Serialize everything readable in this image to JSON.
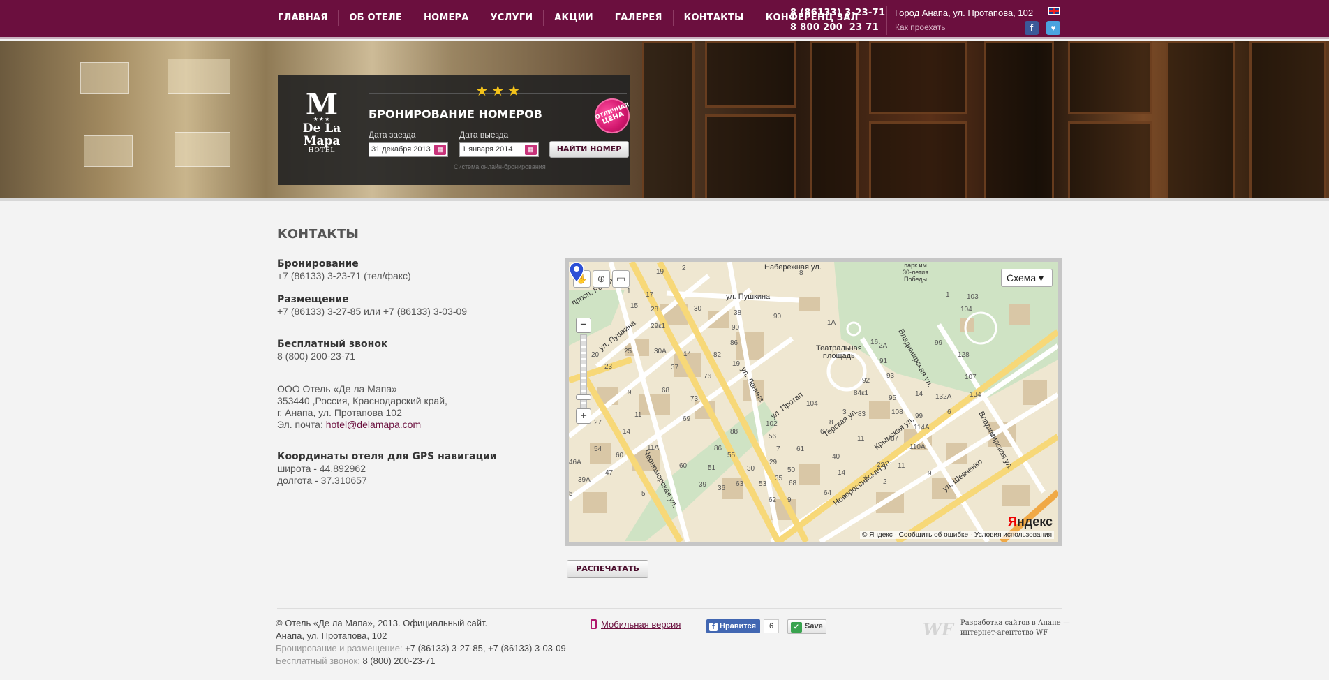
{
  "nav": {
    "items": [
      "ГЛАВНАЯ",
      "ОБ ОТЕЛЕ",
      "НОМЕРА",
      "УСЛУГИ",
      "АКЦИИ",
      "ГАЛЕРЕЯ",
      "КОНТАКТЫ",
      "КОНФЕРЕНЦ ЗАЛ"
    ]
  },
  "header": {
    "phone1": "8 (86133) 3-23-71",
    "phone2": "8 800 200  23 71",
    "address": "Город Анапа, ул. Протапова, 102",
    "route_link": "Как проехать",
    "social_facebook": "f",
    "social_vk": "♥"
  },
  "booking": {
    "logo_mono": "M",
    "logo_stars": "★★★",
    "logo_name": "De La Mapa",
    "logo_hotel": "HOTEL",
    "stars": "★★★",
    "title": "БРОНИРОВАНИЕ НОМЕРОВ",
    "checkin_label": "Дата заезда",
    "checkin_value": "31 декабря 2013",
    "checkout_label": "Дата выезда",
    "checkout_value": "1 января 2014",
    "find_button": "НАЙТИ НОМЕР",
    "system_note": "Система онлайн-бронирования",
    "badge_line1": "ОТЛИЧНАЯ",
    "badge_line2": "ЦЕНА"
  },
  "content": {
    "title": "КОНТАКТЫ",
    "booking_heading": "Бронирование",
    "booking_phone": "+7 (86133) 3-23-71 (тел/факс)",
    "placement_heading": "Размещение",
    "placement_phone": "+7 (86133) 3-27-85 или +7 (86133) 3-03-09",
    "free_heading": "Бесплатный звонок",
    "free_phone": "8 (800) 200-23-71",
    "company": "ООО Отель «Де ла Мапа»",
    "address_line1": "353440 ,Россия, Краснодарский край,",
    "address_line2": "г. Анапа, ул. Протапова 102",
    "email_label": "Эл. почта: ",
    "email": "hotel@delamapa.com",
    "gps_heading": "Координаты отеля для GPS навигации",
    "latitude": "широта - 44.892962",
    "longitude": "долгота - 37.310657",
    "print_button": "РАСПЕЧАТАТЬ"
  },
  "map": {
    "type_selector": "Схема ▾",
    "zoom_in": "+",
    "zoom_out": "−",
    "tool_hand": "✋",
    "tool_zoom": "⊕",
    "tool_ruler": "▭",
    "labels": {
      "naberezhnaya": "Набережная ул.",
      "park": "парк им\n30-летия\nПобеды",
      "pushkina_top": "ул. Пушкина",
      "revolution": "просп. Револю",
      "pushkina_left": "ул. Пушкина",
      "teatr": "Театральная\nплощадь",
      "lenina": "ул. Ленина",
      "protapova": "ул. Протап",
      "terskaya": "Терская ул.",
      "vladimir1": "Владимирская ул.",
      "vladimir2": "Владимирская ул.",
      "krymskaya": "Крымская ул.",
      "chernomorskaya": "Черноморская ул.",
      "novoross": "Новороссийская ул.",
      "shevchenko": "ул. Шевченко"
    },
    "footer_copy": "© Яндекс",
    "footer_error": "Сообщить об ошибке",
    "footer_terms": "Условия использования",
    "logo_y": "Я",
    "logo_rest": "ндекс"
  },
  "footer": {
    "copyright": "© Отель «Де ла Мапа», 2013. Официальный сайт.",
    "address": "Анапа, ул. Протапова, 102",
    "booking_label": "Бронирование и размещение: ",
    "booking_value": "+7 (86133) 3-27-85, +7 (86133) 3-03-09",
    "free_label": "Бесплатный звонок: ",
    "free_value": "8 (800) 200-23-71",
    "mobile_link": "Мобильная версия",
    "fb_like": "Нравится",
    "fb_count": "6",
    "save_button": "Save",
    "save_check": "✓",
    "wf_logo": "WF",
    "dev_link": "Разработка сайтов в Анапе",
    "dev_dash": " —",
    "dev_agency": "интернет-агентство WF"
  }
}
